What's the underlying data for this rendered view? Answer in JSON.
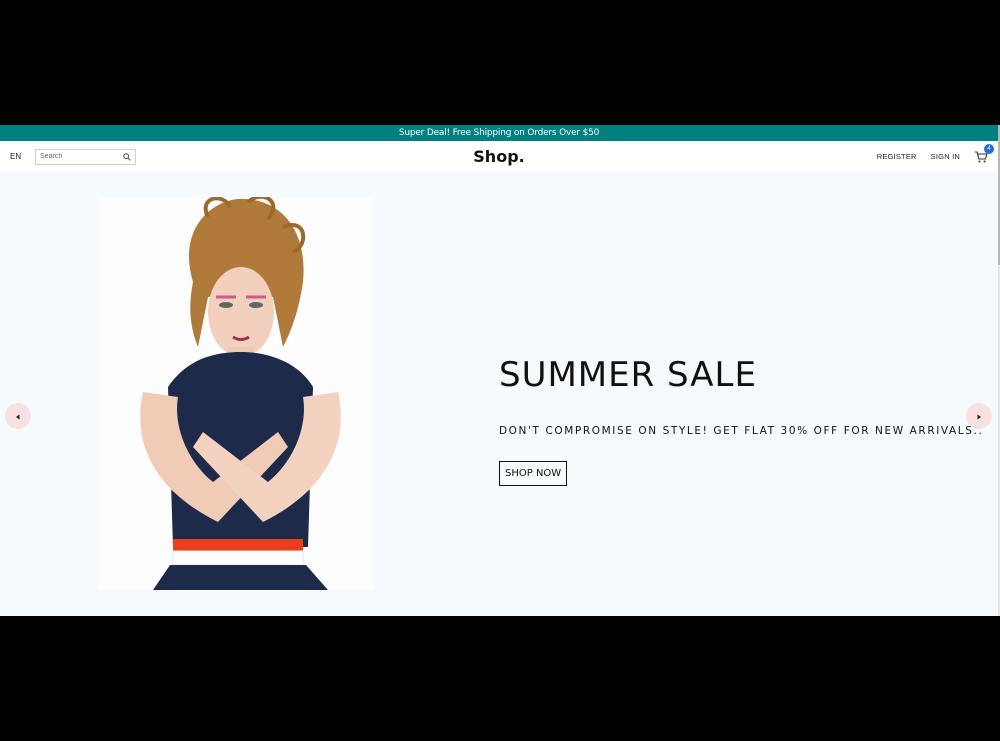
{
  "announcement": {
    "text": "Super Deal! Free Shipping on Orders Over $50"
  },
  "navbar": {
    "language": "EN",
    "search": {
      "placeholder": "Search",
      "value": "",
      "icon": "search-icon"
    },
    "logo": "Shop.",
    "links": {
      "register": "REGISTER",
      "sign_in": "SIGN IN"
    },
    "cart": {
      "icon": "cart-icon",
      "count": "4"
    }
  },
  "slider": {
    "title": "SUMMER SALE",
    "description": "DON'T COMPROMISE ON STYLE! GET FLAT 30% OFF FOR NEW ARRIVALS..",
    "button_label": "SHOP NOW",
    "prev_icon": "arrow-left-icon",
    "next_icon": "arrow-right-icon"
  },
  "colors": {
    "announcement_bg": "#008080",
    "hero_bg": "#f5fbfd",
    "arrow_bg": "#f9e1e1",
    "badge_bg": "#1e6fd9"
  }
}
